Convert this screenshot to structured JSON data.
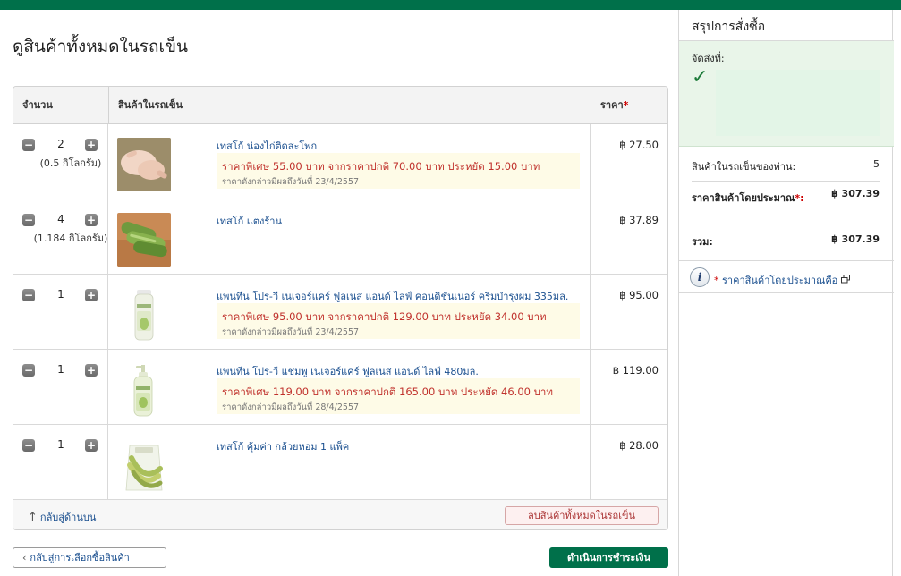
{
  "page": {
    "title": "ดูสินค้าทั้งหมดในรถเข็น"
  },
  "cart": {
    "headers": {
      "qty": "จำนวน",
      "product": "สินค้าในรถเข็น",
      "price": "ราคา",
      "price_mark": "*"
    },
    "items": [
      {
        "qty": "2",
        "weight": "(0.5 กิโลกรัม)",
        "name": "เทสโก้ น่องไก่ติดสะโพก",
        "promo": "ราคาพิเศษ 55.00 บาท จากราคาปกติ 70.00 บาท ประหยัด 15.00 บาท",
        "valid": "ราคาดังกล่าวมีผลถึงวันที่ 23/4/2557",
        "price": "฿ 27.50",
        "thumb_icon": "chicken-leg-image"
      },
      {
        "qty": "4",
        "weight": "(1.184 กิโลกรัม)",
        "name": "เทสโก้ แตงร้าน",
        "promo": "",
        "valid": "",
        "price": "฿ 37.89",
        "thumb_icon": "cucumber-image"
      },
      {
        "qty": "1",
        "weight": "",
        "name": "แพนทีน โปร-วี เนเจอร์แคร์ ฟูลเนส แอนด์ ไลฟ์ คอนดิชันเนอร์ ครีมบำรุงผม 335มล.",
        "promo": "ราคาพิเศษ 95.00 บาท จากราคาปกติ 129.00 บาท ประหยัด 34.00 บาท",
        "valid": "ราคาดังกล่าวมีผลถึงวันที่ 23/4/2557",
        "price": "฿ 95.00",
        "thumb_icon": "conditioner-bottle-image"
      },
      {
        "qty": "1",
        "weight": "",
        "name": "แพนทีน โปร-วี แชมพู เนเจอร์แคร์ ฟูลเนส แอนด์ ไลฟ์ 480มล.",
        "promo": "ราคาพิเศษ 119.00 บาท จากราคาปกติ 165.00 บาท ประหยัด 46.00 บาท",
        "valid": "ราคาดังกล่าวมีผลถึงวันที่ 28/4/2557",
        "price": "฿ 119.00",
        "thumb_icon": "shampoo-pump-bottle-image"
      },
      {
        "qty": "1",
        "weight": "",
        "name": "เทสโก้ คุ้มค่า กล้วยหอม 1 แพ็ค",
        "promo": "",
        "valid": "",
        "price": "฿ 28.00",
        "thumb_icon": "banana-pack-image"
      }
    ],
    "back_to_top": "กลับสู่ด้านบน",
    "clear_all": "ลบสินค้าทั้งหมดในรถเข็น"
  },
  "actions": {
    "continue_shopping": "กลับสู่การเลือกซื้อสินค้า",
    "checkout": "ดำเนินการชำระเงิน"
  },
  "sidebar": {
    "title": "สรุปการสั่งซื้อ",
    "deliver_label": "จัดส่งที่:",
    "items_label": "สินค้าในรถเข็นของท่าน:",
    "items_count": "5",
    "estimate_label": "ราคาสินค้าโดยประมาณ",
    "estimate_mark": "*:",
    "estimate_value": "฿ 307.39",
    "total_label": "รวม:",
    "total_value": "฿ 307.39",
    "note_mark": "*",
    "note_text": "ราคาสินค้าโดยประมาณคือ"
  },
  "colors": {
    "brand_green": "#00704a",
    "promo_red": "#c0312c",
    "link_blue": "#1a4f8f"
  }
}
